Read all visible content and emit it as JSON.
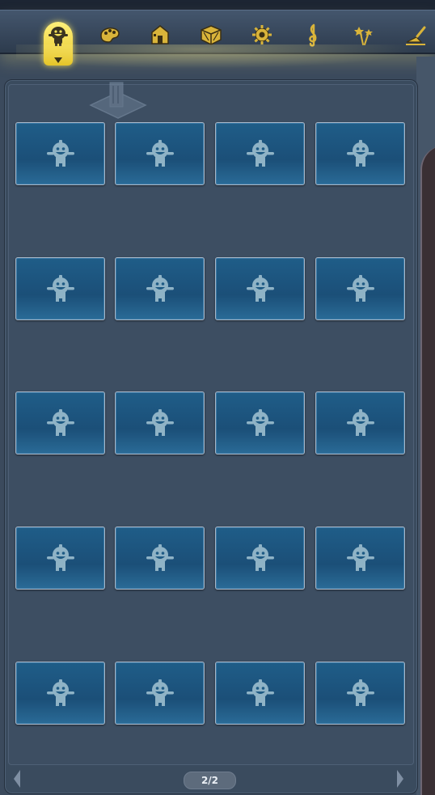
{
  "toolbar": {
    "tabs": [
      {
        "name": "tab-characters",
        "icon": "character-icon",
        "active": true
      },
      {
        "name": "tab-paint",
        "icon": "palette-icon"
      },
      {
        "name": "tab-buildings",
        "icon": "building-icon"
      },
      {
        "name": "tab-objects",
        "icon": "crate-icon"
      },
      {
        "name": "tab-settings",
        "icon": "gear-icon"
      },
      {
        "name": "tab-music",
        "icon": "treble-clef-icon"
      },
      {
        "name": "tab-effects",
        "icon": "fireworks-icon"
      },
      {
        "name": "tab-tools",
        "icon": "trowel-icon"
      }
    ],
    "active_color": "#f7e14a",
    "icon_color": "#d9b43a"
  },
  "grid": {
    "rows": 5,
    "cols": 4,
    "slot_icon": "character-placeholder-icon",
    "slot_color": "#1f5d88"
  },
  "pager": {
    "label": "2/2"
  }
}
